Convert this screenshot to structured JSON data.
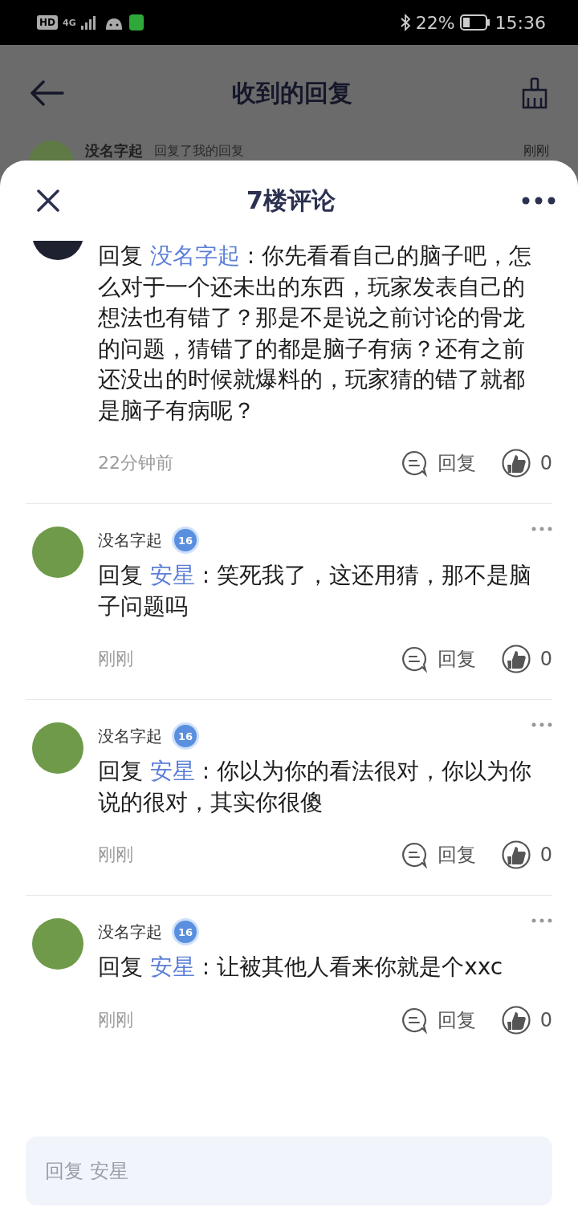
{
  "status_bar": {
    "hd": "HD",
    "network": "4G",
    "battery": "22%",
    "time": "15:36"
  },
  "background_page": {
    "title": "收到的回复",
    "notification": {
      "name": "没名字起",
      "action": "回复了我的回复",
      "time": "刚刚"
    }
  },
  "sheet": {
    "title": "7楼评论",
    "comments": [
      {
        "reply_prefix": "回复",
        "reply_to": "没名字起",
        "text": ": 你先看看自己的脑子吧，怎么对于一个还未出的东西，玩家发表自己的想法也有错了？那是不是说之前讨论的骨龙的问题，猜错了的都是脑子有病？还有之前还没出的时候就爆料的，玩家猜的错了就都是脑子有病呢？",
        "time": "22分钟前",
        "reply_label": "回复",
        "likes": "0"
      },
      {
        "name": "没名字起",
        "badge": "16",
        "reply_prefix": "回复",
        "reply_to": "安星",
        "text": ": 笑死我了，这还用猜，那不是脑子问题吗",
        "time": "刚刚",
        "reply_label": "回复",
        "likes": "0"
      },
      {
        "name": "没名字起",
        "badge": "16",
        "reply_prefix": "回复",
        "reply_to": "安星",
        "text": ": 你以为你的看法很对，你以为你说的很对，其实你很傻",
        "time": "刚刚",
        "reply_label": "回复",
        "likes": "0"
      },
      {
        "name": "没名字起",
        "badge": "16",
        "reply_prefix": "回复",
        "reply_to": "安星",
        "text": ": 让被其他人看来你就是个xxc",
        "time": "刚刚",
        "reply_label": "回复",
        "likes": "0"
      }
    ],
    "input": {
      "placeholder": "回复 安星"
    }
  }
}
